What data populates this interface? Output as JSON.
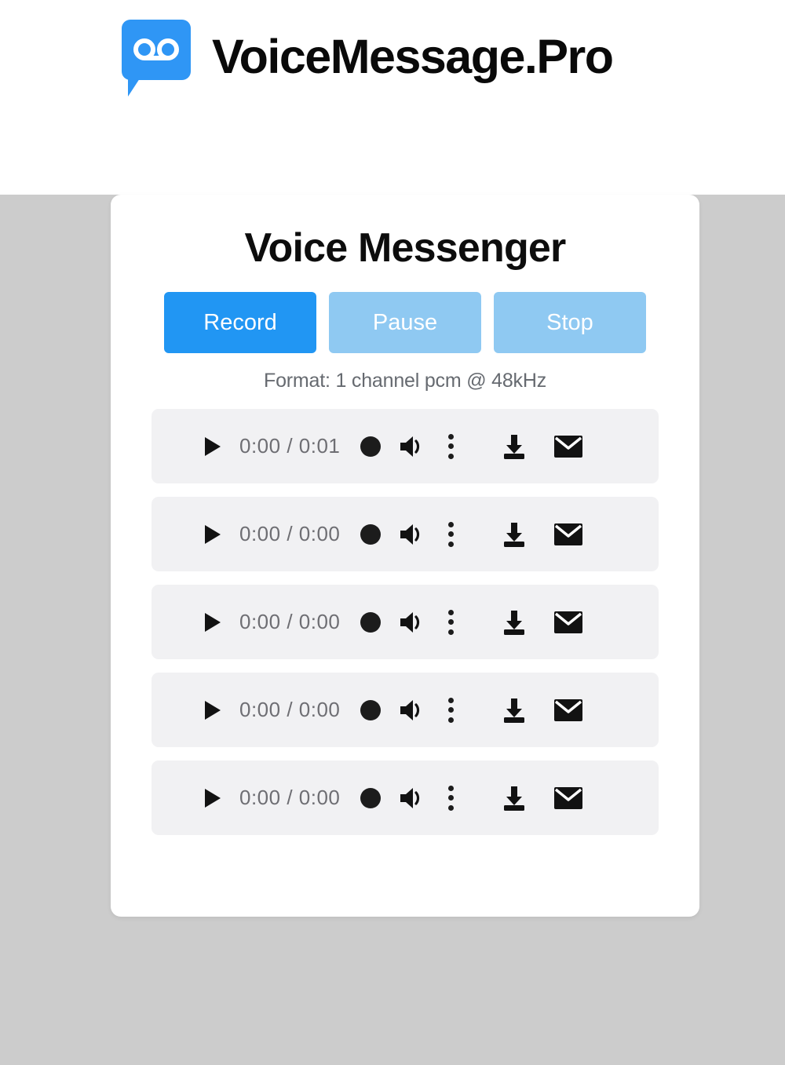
{
  "header": {
    "logo_icon": "voicemail-speech-bubble-icon",
    "brand_title": "VoiceMessage.Pro",
    "brand_color": "#2f96f5"
  },
  "card": {
    "title": "Voice Messenger",
    "format_text": "Format: 1 channel pcm @ 48kHz",
    "controls": [
      {
        "label": "Record",
        "name": "record-button",
        "color": "#2196f3",
        "state": "enabled"
      },
      {
        "label": "Pause",
        "name": "pause-button",
        "color": "#8fc9f2",
        "state": "disabled"
      },
      {
        "label": "Stop",
        "name": "stop-button",
        "color": "#8fc9f2",
        "state": "disabled"
      }
    ],
    "players": [
      {
        "time": "0:00 / 0:01",
        "icons": [
          "play-icon",
          "seek-dot-icon",
          "volume-icon",
          "kebab-menu-icon",
          "download-icon",
          "email-icon"
        ]
      },
      {
        "time": "0:00 / 0:00",
        "icons": [
          "play-icon",
          "seek-dot-icon",
          "volume-icon",
          "kebab-menu-icon",
          "download-icon",
          "email-icon"
        ]
      },
      {
        "time": "0:00 / 0:00",
        "icons": [
          "play-icon",
          "seek-dot-icon",
          "volume-icon",
          "kebab-menu-icon",
          "download-icon",
          "email-icon"
        ]
      },
      {
        "time": "0:00 / 0:00",
        "icons": [
          "play-icon",
          "seek-dot-icon",
          "volume-icon",
          "kebab-menu-icon",
          "download-icon",
          "email-icon"
        ]
      },
      {
        "time": "0:00 / 0:00",
        "icons": [
          "play-icon",
          "seek-dot-icon",
          "volume-icon",
          "kebab-menu-icon",
          "download-icon",
          "email-icon"
        ]
      }
    ]
  },
  "colors": {
    "page_background": "#cccccc",
    "card_background": "#ffffff",
    "row_background": "#f1f1f3",
    "accent": "#2196f3",
    "accent_muted": "#8fc9f2",
    "time_text": "#6e6e73",
    "format_text": "#666a70"
  }
}
